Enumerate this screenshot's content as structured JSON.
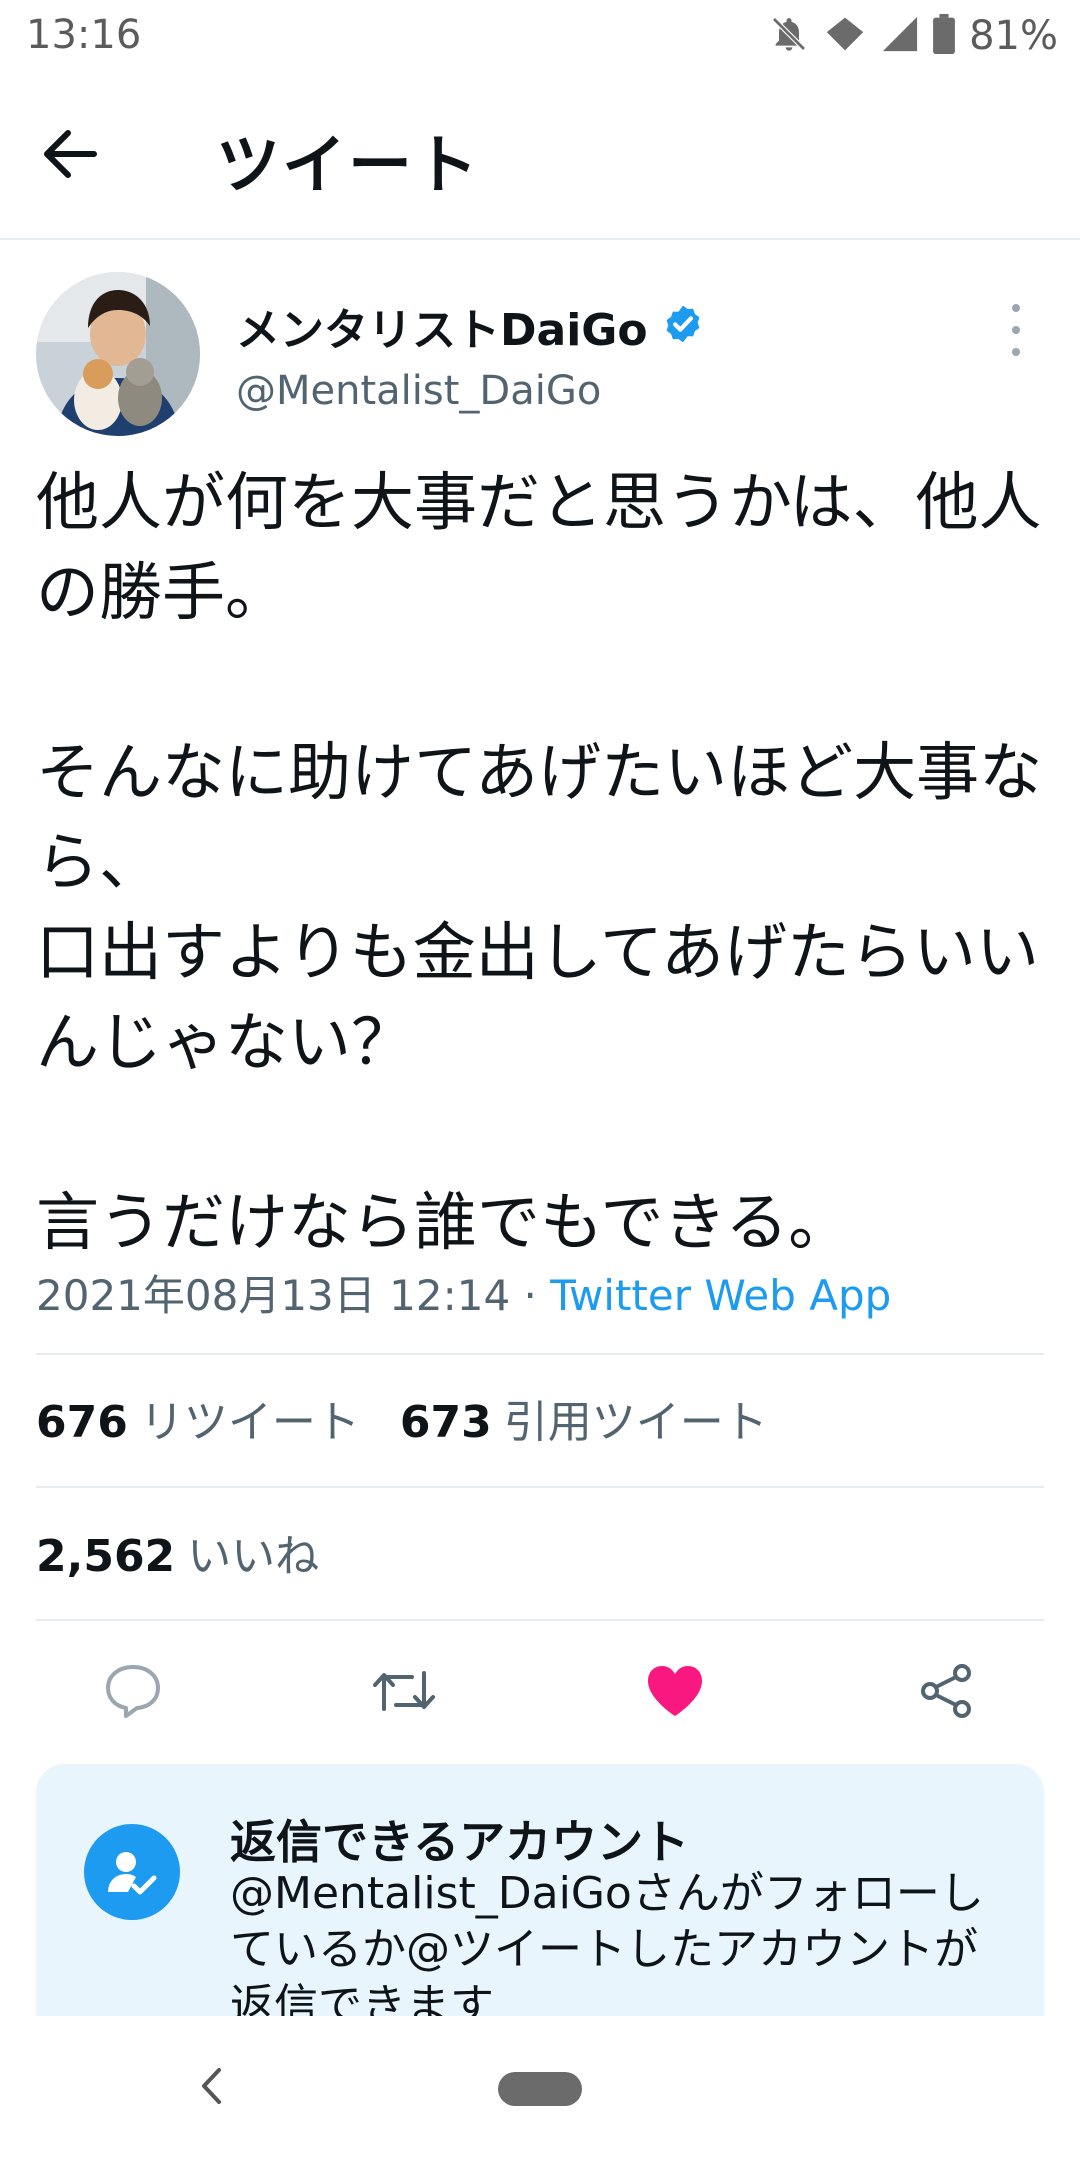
{
  "status_bar": {
    "time": "13:16",
    "battery": "81%"
  },
  "header": {
    "title": "ツイート"
  },
  "tweet": {
    "display_name": "メンタリストDaiGo",
    "handle": "@Mentalist_DaiGo",
    "text": "他人が何を大事だと思うかは、他人の勝手。\n\nそんなに助けてあげたいほど大事なら、\n口出すよりも金出してあげたらいいんじゃない？\n\n言うだけなら誰でもできる。",
    "timestamp": "2021年08月13日 12:14",
    "separator": " · ",
    "source": "Twitter Web App",
    "retweet_count": "676",
    "retweet_label": "リツイート",
    "quote_count": "673",
    "quote_label": "引用ツイート",
    "like_count": "2,562",
    "like_label": "いいね"
  },
  "reply_restriction": {
    "title": "返信できるアカウント",
    "body": "@Mentalist_DaiGoさんがフォローしているか@ツイートしたアカウントが返信できます"
  },
  "icons": {
    "back": "arrow-left-icon",
    "verified": "verified-badge-icon",
    "more": "more-vertical-icon",
    "reply": "reply-icon",
    "retweet": "retweet-icon",
    "like": "heart-icon",
    "share": "share-icon"
  },
  "colors": {
    "accent": "#1d9bf0",
    "like": "#f91880",
    "text": "#0f1419",
    "secondary_text": "#536471",
    "reply_card_bg": "#e8f5fd"
  }
}
